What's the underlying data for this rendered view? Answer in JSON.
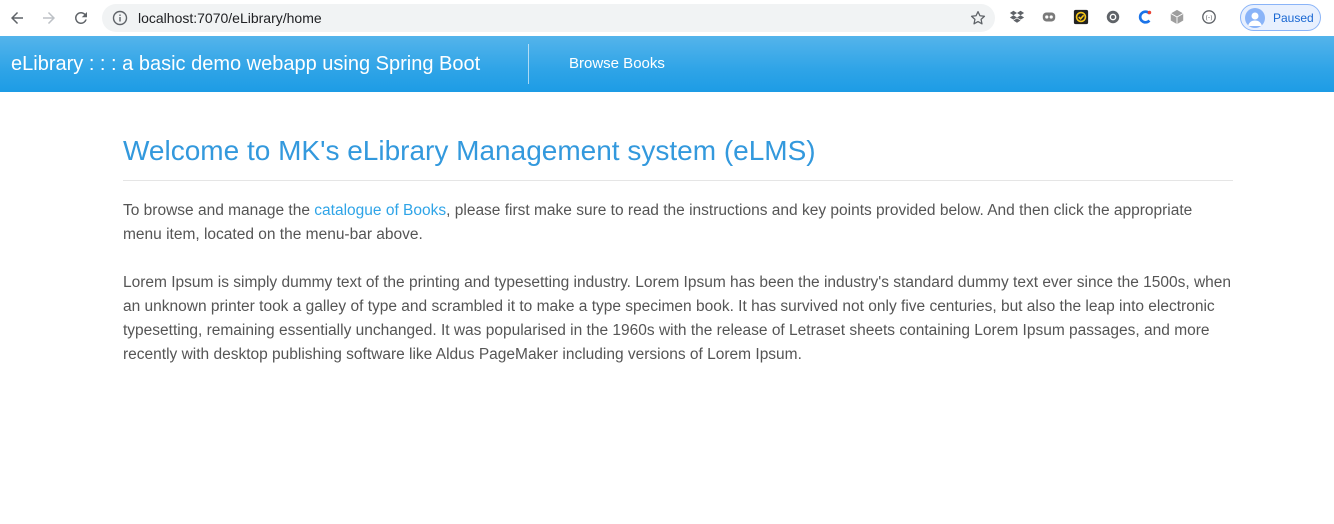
{
  "browser": {
    "url": "localhost:7070/eLibrary/home",
    "profile_status": "Paused",
    "icons": {
      "back": "back-arrow-icon",
      "forward": "forward-arrow-icon",
      "reload": "reload-icon",
      "site_info": "info-icon",
      "bookmark": "star-icon",
      "extensions": [
        "dropbox-icon",
        "extension-robot-icon",
        "extension-check-icon",
        "extension-grammarly-icon",
        "extension-c-icon",
        "extension-cube-icon",
        "extension-dots-icon"
      ]
    }
  },
  "navbar": {
    "brand": "eLibrary : : : a basic demo webapp using Spring Boot",
    "links": [
      {
        "label": "Browse Books"
      }
    ],
    "colors": {
      "background": "#2fa4e7",
      "text": "#ffffff"
    }
  },
  "main": {
    "title": "Welcome to MK's eLibrary Management system (eLMS)",
    "intro_before": "To browse and manage the ",
    "intro_link": "catalogue of Books",
    "intro_after": ", please first make sure to read the instructions and key points provided below. And then click the appropriate menu item, located on the menu-bar above.",
    "lorem": "Lorem Ipsum is simply dummy text of the printing and typesetting industry. Lorem Ipsum has been the industry's standard dummy text ever since the 1500s, when an unknown printer took a galley of type and scrambled it to make a type specimen book. It has survived not only five centuries, but also the leap into electronic typesetting, remaining essentially unchanged. It was popularised in the 1960s with the release of Letraset sheets containing Lorem Ipsum passages, and more recently with desktop publishing software like Aldus PageMaker including versions of Lorem Ipsum.",
    "colors": {
      "title": "#3399dd",
      "link": "#2fa4e7",
      "text": "#555555"
    }
  }
}
